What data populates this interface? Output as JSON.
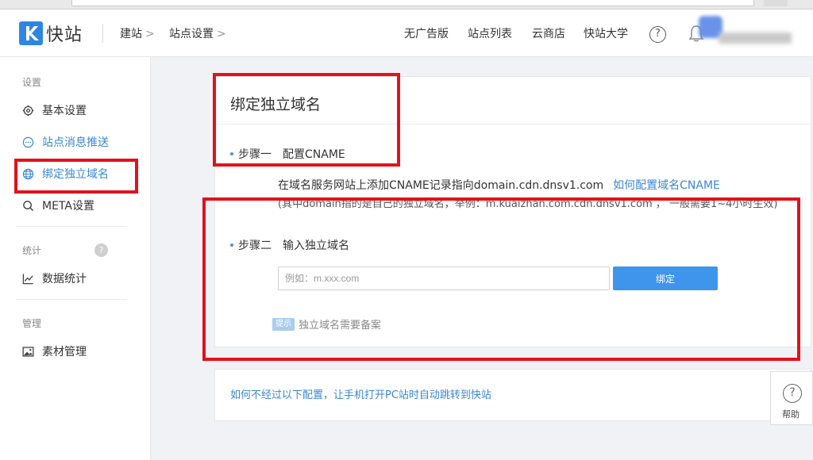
{
  "header": {
    "brand": "快站",
    "breadcrumbs": [
      {
        "label": "建站"
      },
      {
        "label": "站点设置"
      }
    ],
    "chevron": ">",
    "nav": [
      {
        "label": "无广告版"
      },
      {
        "label": "站点列表"
      },
      {
        "label": "云商店"
      },
      {
        "label": "快站大学"
      }
    ],
    "help_glyph": "?"
  },
  "sidebar": {
    "sections": [
      {
        "label": "设置"
      },
      {
        "label": "统计"
      },
      {
        "label": "管理"
      }
    ],
    "items": [
      {
        "label": "基本设置",
        "icon": "gear-icon"
      },
      {
        "label": "站点消息推送",
        "icon": "message-icon"
      },
      {
        "label": "绑定独立域名",
        "icon": "globe-icon"
      },
      {
        "label": "META设置",
        "icon": "search-icon"
      },
      {
        "label": "数据统计",
        "icon": "chart-icon"
      },
      {
        "label": "素材管理",
        "icon": "image-icon"
      }
    ],
    "stats_help_glyph": "?"
  },
  "main": {
    "title": "绑定独立域名",
    "step1": {
      "label": "步骤一",
      "title": "配置CNAME"
    },
    "step1_desc": "在域名服务网站上添加CNAME记录指向domain.cdn.dnsv1.com",
    "step1_link": "如何配置域名CNAME",
    "step1_note": "(其中domain指的是自己的独立域名，举例：m.kuaizhan.com.cdn.dnsv1.com ， 一般需要1~4小时生效)",
    "step2": {
      "label": "步骤二",
      "title": "输入独立域名"
    },
    "domain_input": {
      "value": "",
      "placeholder": "例如：m.xxx.com"
    },
    "bind_button": "绑定",
    "tip_badge": "提示",
    "tip_text": "独立域名需要备案"
  },
  "footer_panel": {
    "link": "如何不经过以下配置，让手机打开PC站时自动跳转到快站"
  },
  "help_widget": {
    "glyph": "?",
    "label": "帮助"
  },
  "colors": {
    "accent": "#3a86d6",
    "button": "#3f95ec",
    "annotation_red": "#e3111b",
    "logo": "#2f86e0"
  }
}
